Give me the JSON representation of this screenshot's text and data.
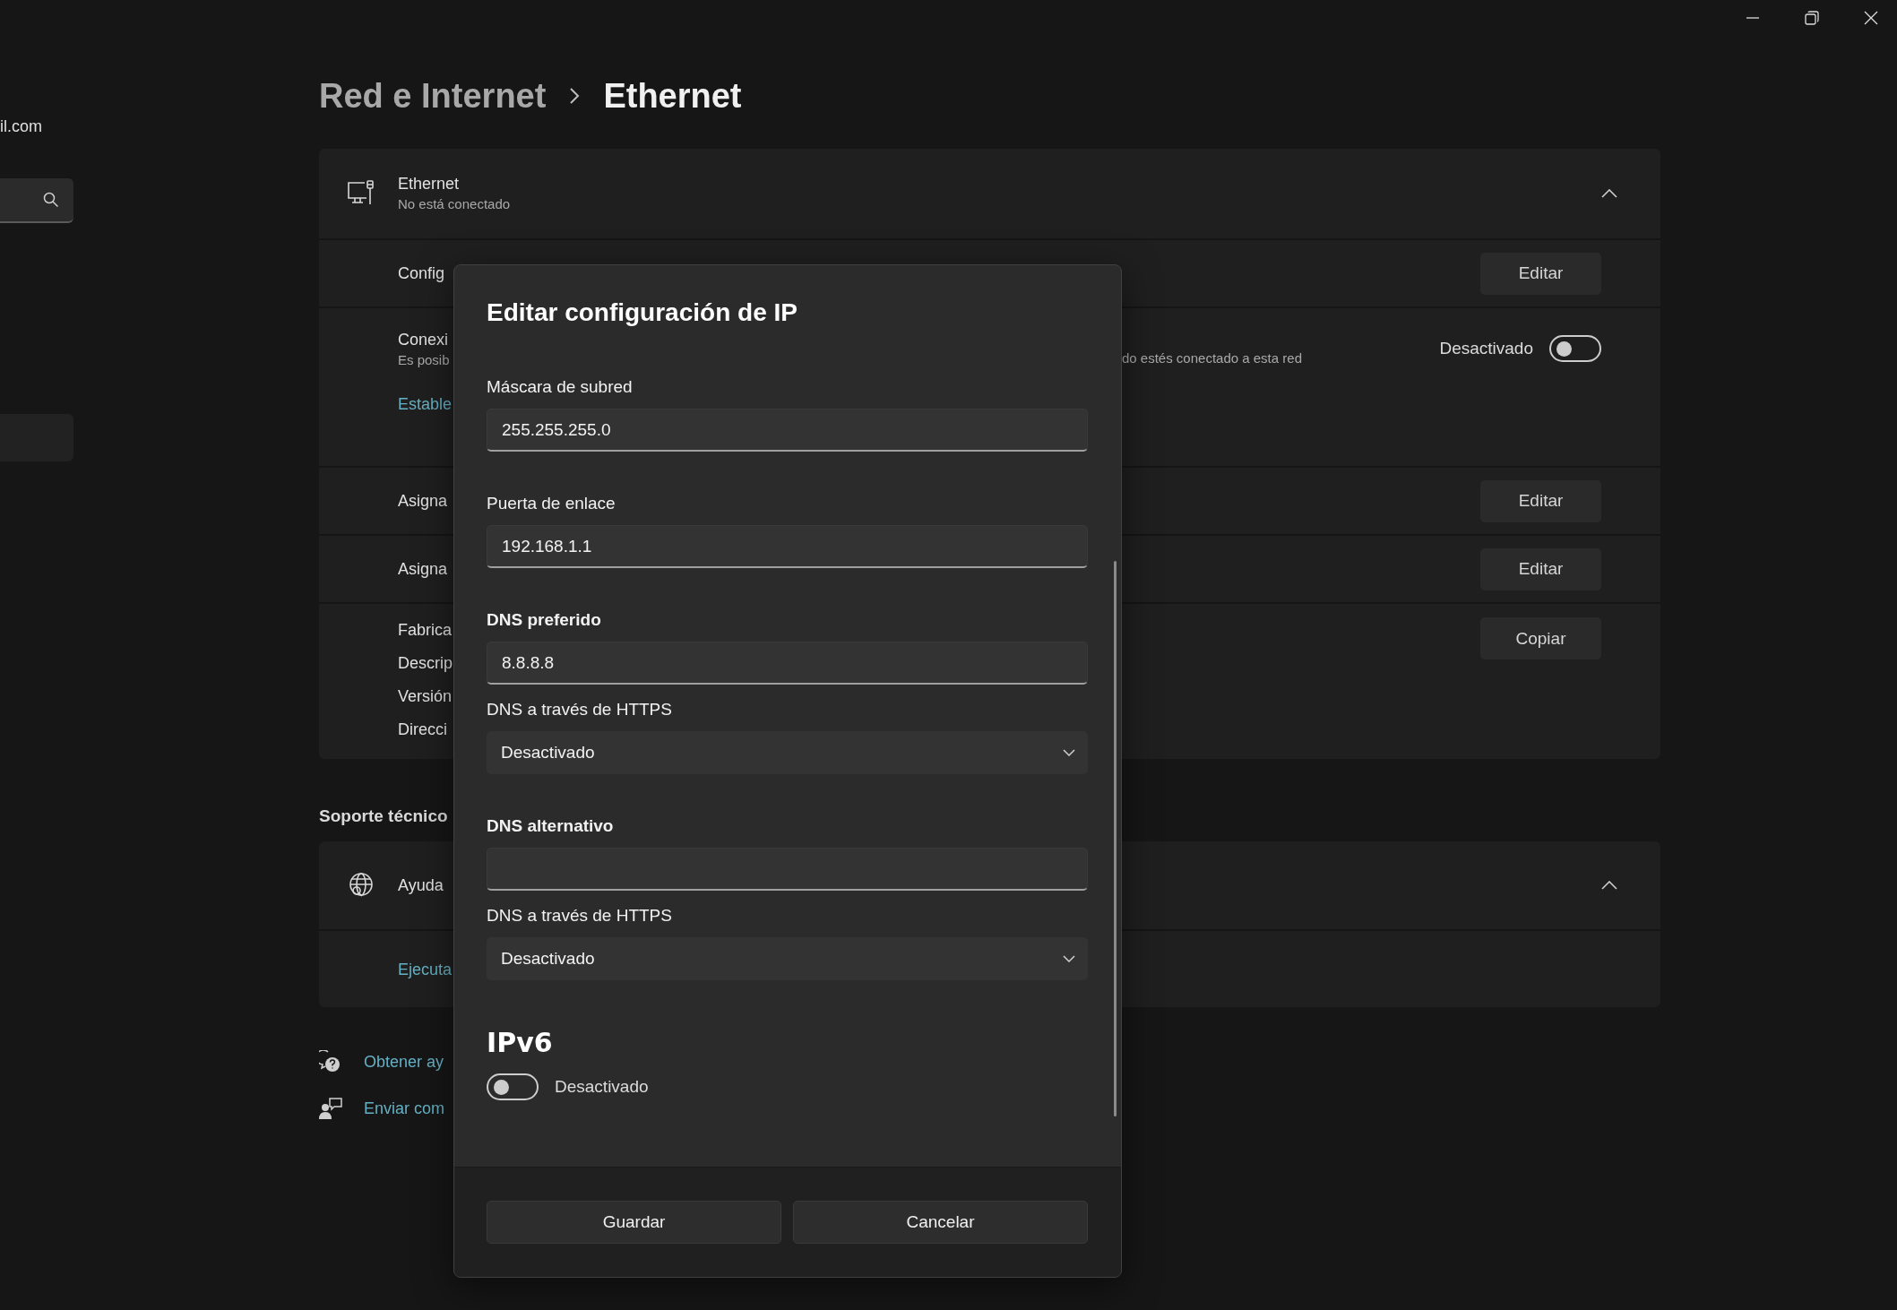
{
  "sidebar": {
    "account_email": "il.com"
  },
  "breadcrumb": {
    "parent": "Red e Internet",
    "current": "Ethernet"
  },
  "ethernet_card": {
    "title": "Ethernet",
    "subtitle": "No está conectado",
    "expanded": true,
    "rows": [
      {
        "kind": "button",
        "label": "Config",
        "button": "Editar"
      },
      {
        "kind": "toggle",
        "label": "Conexi",
        "description_start": "Es posib",
        "description_end": "do estés conectado a esta red",
        "state_label": "Desactivado",
        "on": false,
        "link": "Estable"
      },
      {
        "kind": "button",
        "label": "Asigna",
        "button": "Editar"
      },
      {
        "kind": "button",
        "label": "Asigna",
        "button": "Editar"
      },
      {
        "kind": "properties",
        "labels": [
          "Fabrica",
          "Descrip",
          "Versión",
          "Direcci"
        ],
        "button": "Copiar"
      }
    ]
  },
  "support": {
    "heading": "Soporte técnico",
    "card": {
      "title": "Ayuda",
      "expanded": true,
      "link": "Ejecuta"
    }
  },
  "footer_links": [
    {
      "kind": "help",
      "label": "Obtener ay"
    },
    {
      "kind": "feedback",
      "label": "Enviar com"
    }
  ],
  "dialog": {
    "title": "Editar configuración de IP",
    "fields": [
      {
        "kind": "text",
        "label": "Máscara de subred",
        "bold": false,
        "value": "255.255.255.0"
      },
      {
        "kind": "text",
        "label": "Puerta de enlace",
        "bold": false,
        "value": "192.168.1.1"
      },
      {
        "kind": "text",
        "label": "DNS preferido",
        "bold": true,
        "value": "8.8.8.8"
      },
      {
        "kind": "dropdown",
        "label": "DNS a través de HTTPS",
        "bold": false,
        "value": "Desactivado"
      },
      {
        "kind": "text",
        "label": "DNS alternativo",
        "bold": true
      },
      {
        "kind": "dropdown",
        "label": "DNS a través de HTTPS",
        "bold": false,
        "value": "Desactivado"
      }
    ],
    "ipv6": {
      "heading": "IPv6",
      "on": false,
      "state_label": "Desactivado"
    },
    "buttons": [
      "Guardar",
      "Cancelar"
    ]
  }
}
